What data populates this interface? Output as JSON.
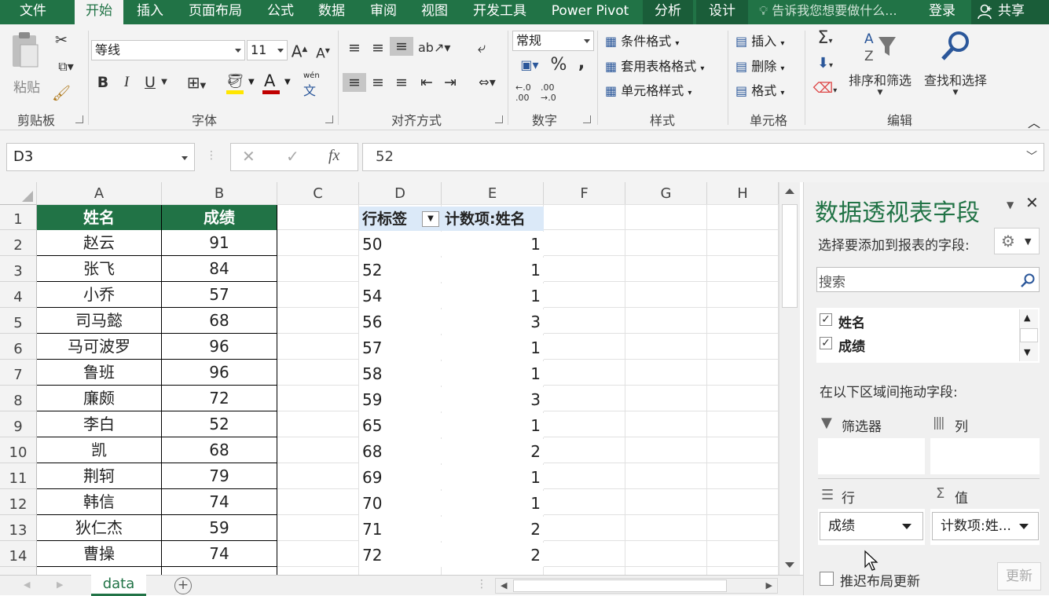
{
  "menubar": {
    "tabs": [
      "文件",
      "开始",
      "插入",
      "页面布局",
      "公式",
      "数据",
      "审阅",
      "视图",
      "开发工具",
      "Power Pivot",
      "分析",
      "设计"
    ],
    "active_tab": "开始",
    "tell_me": "告诉我您想要做什么...",
    "login": "登录",
    "share": "共享"
  },
  "ribbon": {
    "clipboard": {
      "paste": "粘贴",
      "label": "剪贴板"
    },
    "font": {
      "name": "等线",
      "size": "11",
      "grow": "A",
      "shrink": "A",
      "bold": "B",
      "italic": "I",
      "underline": "U",
      "phonetic_top": "wén",
      "phonetic_bottom": "文",
      "label": "字体"
    },
    "alignment": {
      "label": "对齐方式"
    },
    "number": {
      "format": "常规",
      "percent": "%",
      "comma": ",",
      "inc_dec_top": "←.0 .00",
      "inc_dec_bottom": ".00 →.0",
      "label": "数字"
    },
    "styles": {
      "conditional": "条件格式",
      "table": "套用表格格式",
      "cell": "单元格样式",
      "label": "样式"
    },
    "cells": {
      "insert": "插入",
      "delete": "删除",
      "format": "格式",
      "label": "单元格"
    },
    "editing": {
      "sort": "排序和筛选",
      "find": "查找和选择",
      "label": "编辑"
    }
  },
  "formula_bar": {
    "name_box": "D3",
    "cancel": "✕",
    "enter": "✓",
    "fx": "fx",
    "value": "52"
  },
  "sheet": {
    "columns": [
      "A",
      "B",
      "C",
      "D",
      "E",
      "F",
      "G",
      "H"
    ],
    "rows": [
      "1",
      "2",
      "3",
      "4",
      "5",
      "6",
      "7",
      "8",
      "9",
      "10",
      "11",
      "12",
      "13",
      "14"
    ],
    "table_headers": [
      "姓名",
      "成绩"
    ],
    "names": [
      "赵云",
      "张飞",
      "小乔",
      "司马懿",
      "马可波罗",
      "鲁班",
      "廉颇",
      "李白",
      "凯",
      "荆轲",
      "韩信",
      "狄仁杰",
      "曹操"
    ],
    "scores": [
      "91",
      "84",
      "57",
      "68",
      "96",
      "96",
      "72",
      "52",
      "68",
      "79",
      "74",
      "59",
      "74"
    ],
    "pivot_headers": [
      "行标签",
      "计数项:姓名"
    ],
    "pivot_labels": [
      "50",
      "52",
      "54",
      "56",
      "57",
      "58",
      "59",
      "65",
      "68",
      "69",
      "70",
      "71",
      "72"
    ],
    "pivot_counts": [
      "1",
      "1",
      "1",
      "3",
      "1",
      "1",
      "3",
      "1",
      "2",
      "1",
      "1",
      "2",
      "2"
    ],
    "tab_name": "data"
  },
  "pivot_pane": {
    "title": "数据透视表字段",
    "subtitle": "选择要添加到报表的字段:",
    "search_placeholder": "搜索",
    "fields": [
      "姓名",
      "成绩"
    ],
    "drag_hint": "在以下区域间拖动字段:",
    "filters": "筛选器",
    "columns": "列",
    "rows": "行",
    "values": "值",
    "rows_value": "成绩",
    "values_value": "计数项:姓...",
    "defer": "推迟布局更新",
    "update": "更新"
  }
}
